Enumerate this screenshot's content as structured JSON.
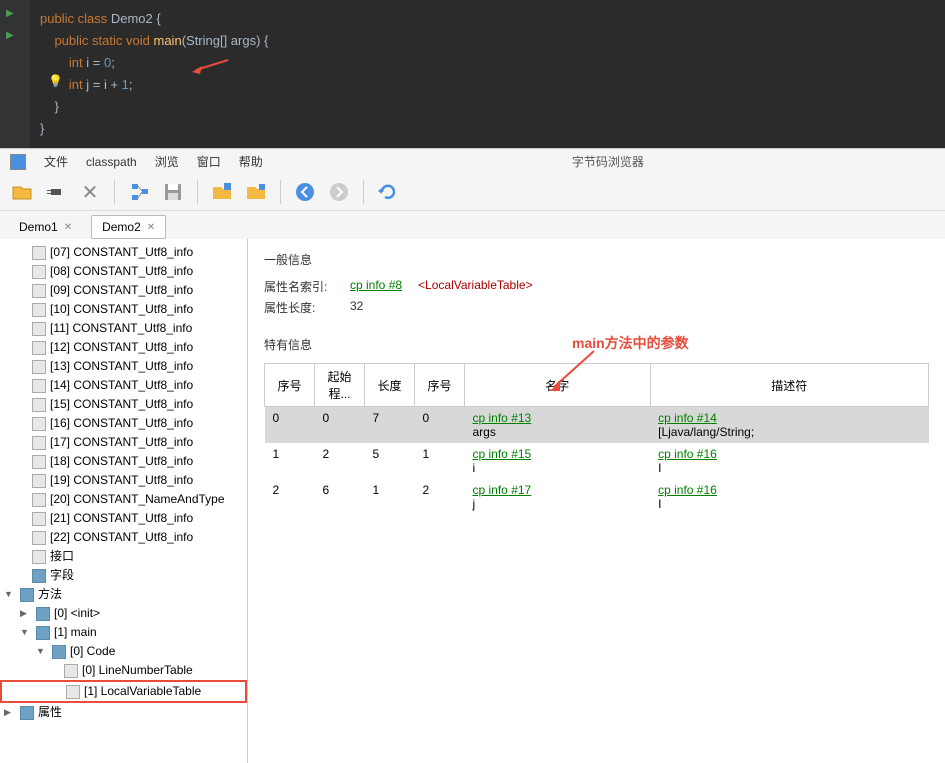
{
  "code": {
    "line1_kw1": "public",
    "line1_kw2": "class",
    "line1_cls": "Demo2",
    "line1_brace": " {",
    "line2_kw1": "public",
    "line2_kw2": "static",
    "line2_kw3": "void",
    "line2_method": "main",
    "line2_params": "(String[] args) {",
    "line3_type": "int",
    "line3_var": " i = ",
    "line3_num": "0",
    "line3_semi": ";",
    "line4_type": "int",
    "line4_var": " j = i + ",
    "line4_num": "1",
    "line4_semi": ";",
    "line5": "    }",
    "line6": "}"
  },
  "menu": {
    "file": "文件",
    "classpath": "classpath",
    "browse": "浏览",
    "window": "窗口",
    "help": "帮助",
    "title": "字节码浏览器"
  },
  "tabs": {
    "t1": "Demo1",
    "t2": "Demo2"
  },
  "tree": {
    "items": [
      "[07] CONSTANT_Utf8_info",
      "[08] CONSTANT_Utf8_info",
      "[09] CONSTANT_Utf8_info",
      "[10] CONSTANT_Utf8_info",
      "[11] CONSTANT_Utf8_info",
      "[12] CONSTANT_Utf8_info",
      "[13] CONSTANT_Utf8_info",
      "[14] CONSTANT_Utf8_info",
      "[15] CONSTANT_Utf8_info",
      "[16] CONSTANT_Utf8_info",
      "[17] CONSTANT_Utf8_info",
      "[18] CONSTANT_Utf8_info",
      "[19] CONSTANT_Utf8_info",
      "[20] CONSTANT_NameAndType",
      "[21] CONSTANT_Utf8_info",
      "[22] CONSTANT_Utf8_info"
    ],
    "interface_label": "接口",
    "fields_label": "字段",
    "methods_label": "方法",
    "m0": "[0] <init>",
    "m1": "[1] main",
    "code": "[0] Code",
    "lnt": "[0] LineNumberTable",
    "lvt": "[1] LocalVariableTable",
    "attrs_label": "属性"
  },
  "detail": {
    "section1": "一般信息",
    "name_index_label": "属性名索引:",
    "name_index_link": "cp info #8",
    "name_index_tag": "<LocalVariableTable>",
    "length_label": "属性长度:",
    "length_val": "32",
    "section2": "特有信息",
    "annotation": "main方法中的参数",
    "headers": {
      "h1": "序号",
      "h2": "起始程...",
      "h3": "长度",
      "h4": "序号",
      "h5": "名字",
      "h6": "描述符"
    },
    "rows": [
      {
        "idx": "0",
        "start": "0",
        "len": "7",
        "slot": "0",
        "name_link": "cp info #13",
        "name": "args",
        "desc_link": "cp info #14",
        "desc": "[Ljava/lang/String;"
      },
      {
        "idx": "1",
        "start": "2",
        "len": "5",
        "slot": "1",
        "name_link": "cp info #15",
        "name": "i",
        "desc_link": "cp info #16",
        "desc": "I"
      },
      {
        "idx": "2",
        "start": "6",
        "len": "1",
        "slot": "2",
        "name_link": "cp info #17",
        "name": "j",
        "desc_link": "cp info #16",
        "desc": "I"
      }
    ]
  }
}
